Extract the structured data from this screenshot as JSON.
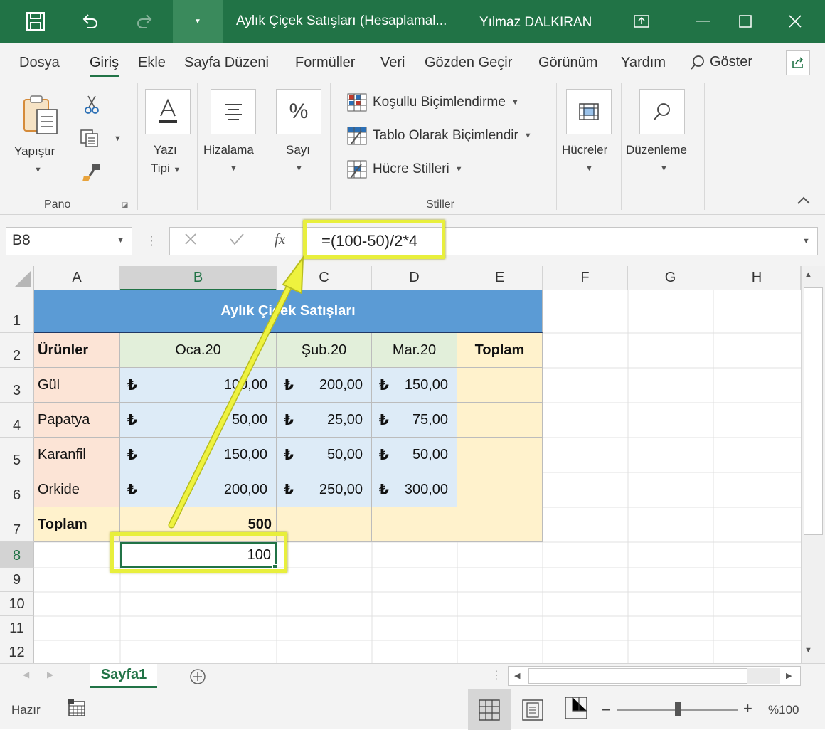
{
  "window": {
    "doc_title": "Aylık Çiçek Satışları (Hesaplamal...",
    "user": "Yılmaz DALKIRAN"
  },
  "tabs": [
    "Dosya",
    "Giriş",
    "Ekle",
    "Sayfa Düzeni",
    "Formüller",
    "Veri",
    "Gözden Geçir",
    "Görünüm",
    "Yardım",
    "Göster"
  ],
  "ribbon": {
    "paste": "Yapıştır",
    "clipboard_group": "Pano",
    "font_l1": "Yazı",
    "font_l2": "Tipi",
    "alignment": "Hizalama",
    "number": "Sayı",
    "cond_format": "Koşullu Biçimlendirme",
    "format_table": "Tablo Olarak Biçimlendir",
    "cell_styles": "Hücre Stilleri",
    "styles_group": "Stiller",
    "cells": "Hücreler",
    "editing": "Düzenleme"
  },
  "formula_bar": {
    "name_box": "B8",
    "fx": "fx",
    "formula": "=(100-50)/2*4"
  },
  "columns": [
    "A",
    "B",
    "C",
    "D",
    "E",
    "F",
    "G",
    "H"
  ],
  "rows": [
    "1",
    "2",
    "3",
    "4",
    "5",
    "6",
    "7",
    "8",
    "9",
    "10",
    "11",
    "12"
  ],
  "table": {
    "title": "Aylık Çiçek Satışları",
    "headers": [
      "Ürünler",
      "Oca.20",
      "Şub.20",
      "Mar.20",
      "Toplam"
    ],
    "currency": "₺",
    "rows": [
      {
        "name": "Gül",
        "v": [
          "100,00",
          "200,00",
          "150,00"
        ]
      },
      {
        "name": "Papatya",
        "v": [
          "50,00",
          "25,00",
          "75,00"
        ]
      },
      {
        "name": "Karanfil",
        "v": [
          "150,00",
          "50,00",
          "50,00"
        ]
      },
      {
        "name": "Orkide",
        "v": [
          "200,00",
          "250,00",
          "300,00"
        ]
      }
    ],
    "total_label": "Toplam",
    "total_b": "500",
    "b8_value": "100"
  },
  "sheet_tab": "Sayfa1",
  "status": {
    "ready": "Hazır",
    "zoom": "%100",
    "zoom_level_percent": 100
  },
  "colors": {
    "excel_green": "#217346",
    "title_fill": "#5b9bd5",
    "product_fill": "#fce4d6",
    "header_fill": "#e2efda",
    "value_fill": "#ddebf7",
    "total_fill": "#fff2cc",
    "highlight": "#e8ef3c"
  }
}
